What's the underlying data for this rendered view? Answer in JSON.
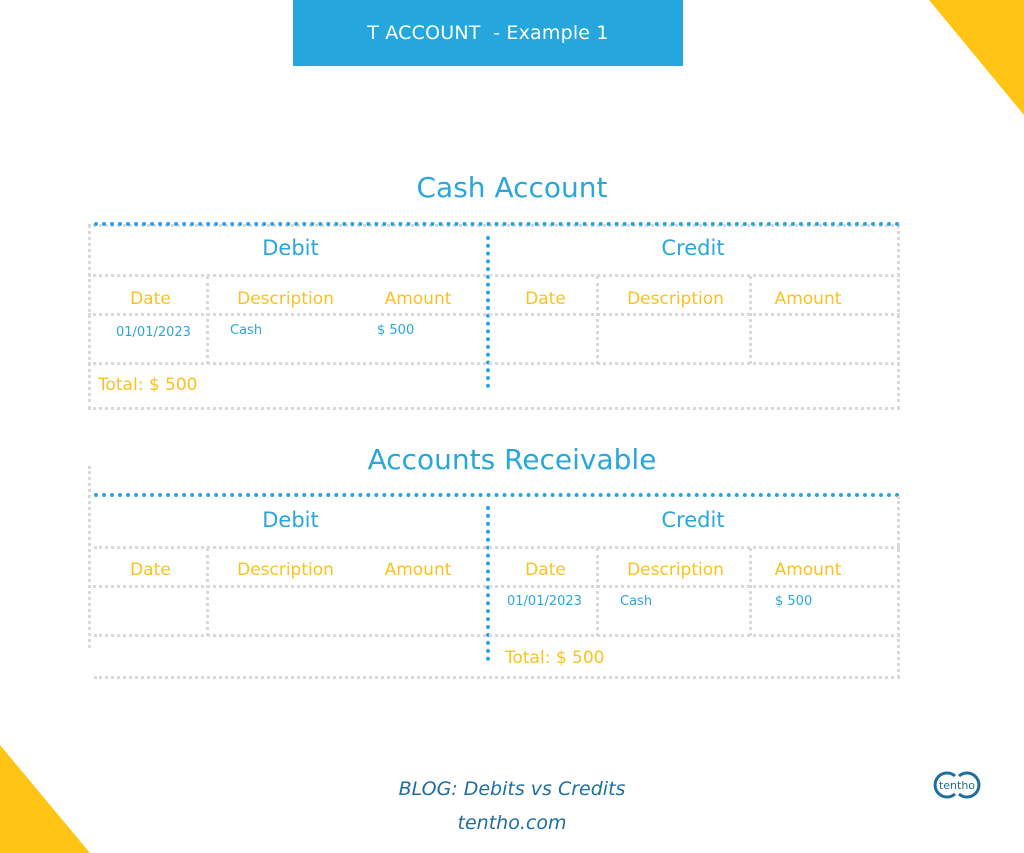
{
  "banner": {
    "title": "T ACCOUNT  - Example 1"
  },
  "accounts": [
    {
      "title": "Cash Account",
      "debit": {
        "label": "Debit",
        "columns": [
          "Date",
          "Description",
          "Amount"
        ],
        "rows": [
          {
            "date": "01/01/2023",
            "description": "Cash",
            "amount": "$ 500"
          }
        ],
        "total": "Total: $ 500"
      },
      "credit": {
        "label": "Credit",
        "columns": [
          "Date",
          "Description",
          "Amount"
        ],
        "rows": [],
        "total": ""
      }
    },
    {
      "title": "Accounts Receivable",
      "debit": {
        "label": "Debit",
        "columns": [
          "Date",
          "Description",
          "Amount"
        ],
        "rows": [],
        "total": ""
      },
      "credit": {
        "label": "Credit",
        "columns": [
          "Date",
          "Description",
          "Amount"
        ],
        "rows": [
          {
            "date": "01/01/2023",
            "description": "Cash",
            "amount": "$ 500"
          }
        ],
        "total": "Total: $ 500"
      }
    }
  ],
  "footer": {
    "blog": "BLOG: Debits vs Credits",
    "site": "tentho.com"
  },
  "logo": {
    "text": "tentho",
    "icon": "tentho-infinity-logo"
  },
  "colors": {
    "primary": "#2AA6DD",
    "accent": "#FBC21D",
    "banner": "#25A7DE",
    "corner": "#FFC414",
    "footer": "#1E6E9F"
  }
}
